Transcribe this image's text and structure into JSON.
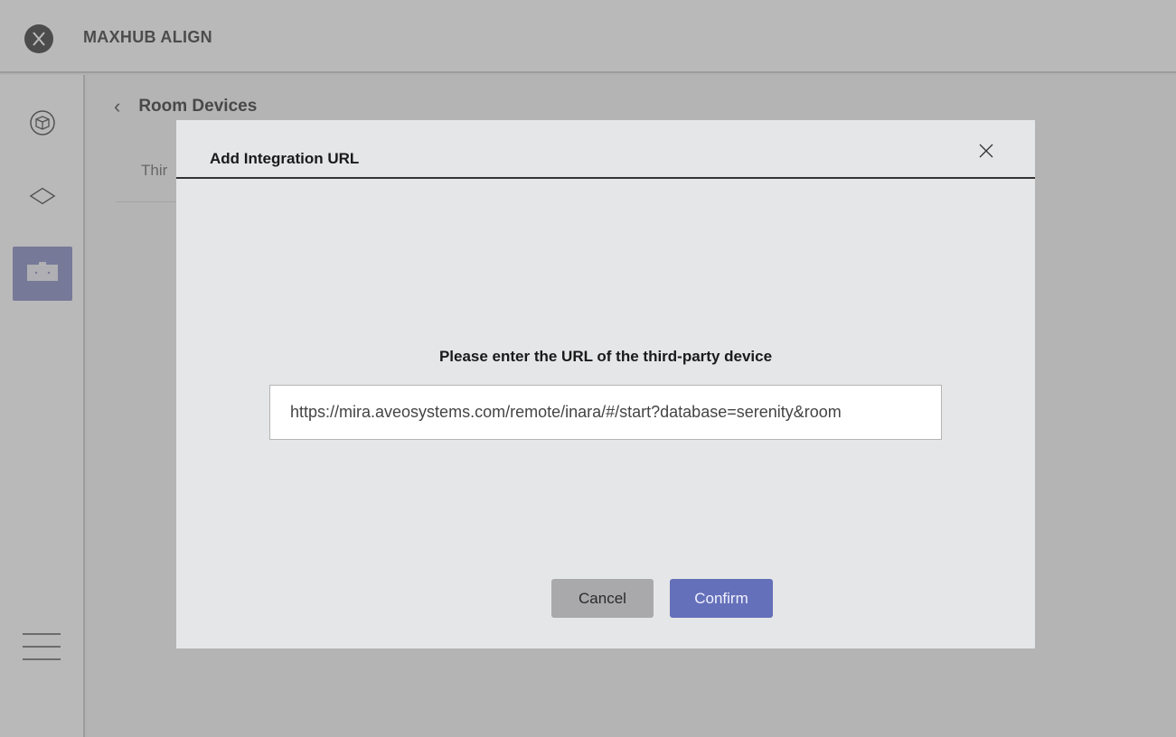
{
  "app": {
    "title": "MAXHUB ALIGN",
    "logo_icon": "x-logo-icon"
  },
  "sidebar": {
    "items": [
      {
        "icon": "cube-icon"
      },
      {
        "icon": "layers-icon"
      },
      {
        "icon": "device-box-icon",
        "active": true
      }
    ],
    "menu_icon": "hamburger-menu-icon"
  },
  "page": {
    "title": "Room Devices",
    "tab_label": "Thir"
  },
  "modal": {
    "title": "Add Integration URL",
    "prompt": "Please enter the URL of the third-party device",
    "url_value": "https://mira.aveosystems.com/remote/inara/#/start?database=serenity&room",
    "cancel_label": "Cancel",
    "confirm_label": "Confirm"
  },
  "colors": {
    "accent": "#6470b9",
    "sidebar_active": "#8f94c8",
    "cancel": "#a9a9ab",
    "modal_bg": "#e5e6e8"
  }
}
